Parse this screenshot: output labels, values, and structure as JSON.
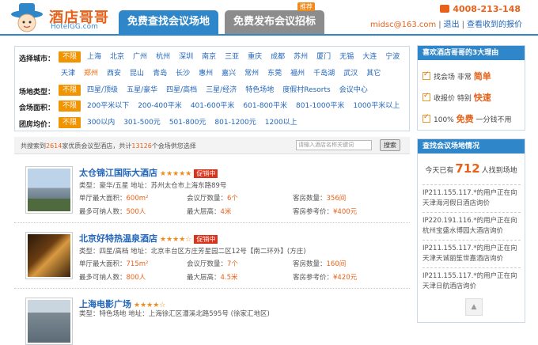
{
  "logo": {
    "cn": "酒店哥哥",
    "en": "HotelGG.com"
  },
  "tabs": [
    {
      "label": "免费查找会议场地"
    },
    {
      "label": "免费发布会议招标"
    }
  ],
  "tab_badge": "推荐",
  "phone": "4008-213-148",
  "user": {
    "email": "midsc@163.com",
    "logout": "退出",
    "messages": "查看收到的报价"
  },
  "filters": [
    {
      "label": "选择城市：",
      "options": [
        "不限",
        "上海",
        "北京",
        "广州",
        "杭州",
        "深圳",
        "南京",
        "三亚",
        "重庆",
        "成都",
        "苏州",
        "厦门",
        "无锡",
        "大连",
        "宁波"
      ],
      "selected": 0
    },
    {
      "label": "",
      "options": [
        "天津",
        "郑州",
        "西安",
        "昆山",
        "青岛",
        "长沙",
        "惠州",
        "嘉兴",
        "常州",
        "东莞",
        "福州",
        "千岛湖",
        "武汉",
        "其它"
      ],
      "highlight": 1
    },
    {
      "label": "场地类型：",
      "options": [
        "不限",
        "四星/顶级",
        "五星/豪华",
        "四星/高档",
        "三星/经济",
        "特色场地",
        "度假村Resorts",
        "会议中心"
      ],
      "selected": 0
    },
    {
      "label": "会场面积：",
      "options": [
        "不限",
        "200平米以下",
        "200-400平米",
        "401-600平米",
        "601-800平米",
        "801-1000平米",
        "1000平米以上"
      ],
      "selected": 0
    },
    {
      "label": "团房均价：",
      "options": [
        "不限",
        "300以内",
        "301-500元",
        "501-800元",
        "801-1200元",
        "1200以上"
      ],
      "selected": 0
    }
  ],
  "results": {
    "prefix": "共搜索到",
    "hotels": "2614",
    "middle": "家优质会议型酒店，共计",
    "venues": "13126",
    "suffix": "个会场供您选择",
    "search_placeholder": "请输入酒店名称关键词",
    "search_button": "搜索"
  },
  "hotels": [
    {
      "name": "太仓锦江国际大酒店",
      "stars": "★★★★★",
      "promo": "促销中",
      "type": "类型：豪华/五星  地址：苏州太仓市上海东路89号",
      "area_label": "单厅最大面积：",
      "area": "600m²",
      "halls_label": "会议厅数量：",
      "halls": "6个",
      "rooms_label": "客房数量：",
      "rooms": "356间",
      "capacity_label": "最多可纳人数：",
      "capacity": "500人",
      "height_label": "最大层高：",
      "height": "4米",
      "price_label": "客房参考价：",
      "price": "¥400元"
    },
    {
      "name": "北京好特热温泉酒店",
      "stars": "★★★★☆",
      "promo": "促销中",
      "type": "类型：四星/高档  地址：北京丰台区方庄芳星园二区12号【南二环外】(方庄)",
      "area_label": "单厅最大面积：",
      "area": "715m²",
      "halls_label": "会议厅数量：",
      "halls": "7个",
      "rooms_label": "客房数量：",
      "rooms": "160间",
      "capacity_label": "最多可纳人数：",
      "capacity": "800人",
      "height_label": "最大层高：",
      "height": "4.5米",
      "price_label": "客房参考价：",
      "price": "¥420元"
    },
    {
      "name": "上海电影广场",
      "stars": "★★★★☆",
      "promo": "",
      "type": "类型：特色场地  地址：上海徐汇区漕溪北路595号 (徐家汇地区)",
      "area_label": "",
      "area": "",
      "halls_label": "",
      "halls": "",
      "rooms_label": "",
      "rooms": "",
      "capacity_label": "",
      "capacity": "",
      "height_label": "",
      "height": "",
      "price_label": "",
      "price": ""
    }
  ],
  "why": {
    "title": "喜欢酒店哥哥的3大理由",
    "items": [
      {
        "pre": "找会场 非常",
        "big": "简单"
      },
      {
        "pre": "收报价 特别",
        "big": "快速"
      },
      {
        "pre": "100%",
        "big": "免费",
        "post": "一分钱不用"
      }
    ]
  },
  "stats": {
    "title": "查找会议场地情况",
    "count_pre": "今天已有",
    "count": "712",
    "count_post": "人找到场地",
    "entries": [
      "IP211.155.117.*的用户正在向天津海河假日酒店询价",
      "IP220.191.116.*的用户正在向杭州宝盛水博园大酒店询价",
      "IP211.155.117.*的用户正在向天津天诚丽笙世嘉酒店询价",
      "IP211.155.117.*的用户正在向天津日航酒店询价"
    ]
  },
  "colors": {
    "accent": "#2f86c8",
    "orange": "#e8611a",
    "selected": "#f29400"
  },
  "to_top": "▲"
}
